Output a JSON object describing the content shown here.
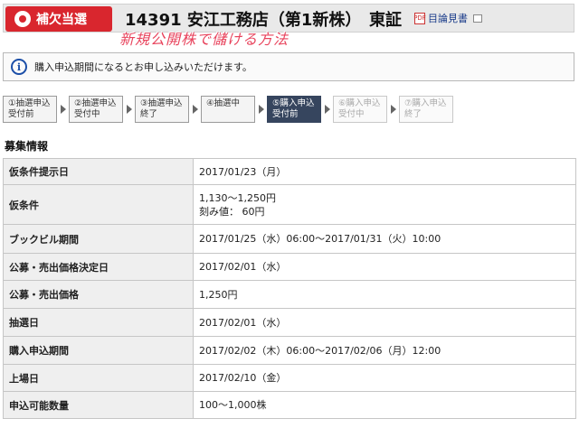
{
  "header": {
    "badge": "補欠当選",
    "title": "14391 安江工務店（第1新株）",
    "market": "東証",
    "prospectus_link": "目論見書",
    "overlay_text": "新規公開株で儲ける方法",
    "icons": [
      "pin-icon",
      "pdf-icon",
      "external-window-icon"
    ]
  },
  "notice": {
    "icon": "info-icon",
    "text": "購入申込期間になるとお申し込みいただけます。"
  },
  "steps": [
    {
      "label": "①抽選申込\n受付前",
      "state": "done"
    },
    {
      "label": "②抽選申込\n受付中",
      "state": "done"
    },
    {
      "label": "③抽選申込\n終了",
      "state": "done"
    },
    {
      "label": "④抽選中",
      "state": "done"
    },
    {
      "label": "⑤購入申込\n受付前",
      "state": "active"
    },
    {
      "label": "⑥購入申込\n受付中",
      "state": "future"
    },
    {
      "label": "⑦購入申込\n終了",
      "state": "future"
    }
  ],
  "section": {
    "title": "募集情報"
  },
  "rows": [
    {
      "key": "仮条件提示日",
      "value": [
        "2017/01/23（月）"
      ]
    },
    {
      "key": "仮条件",
      "value": [
        "1,130～1,250円",
        "刻み値： 60円"
      ]
    },
    {
      "key": "ブックビル期間",
      "value": [
        "2017/01/25（水）06:00～2017/01/31（火）10:00"
      ]
    },
    {
      "key": "公募・売出価格決定日",
      "value": [
        "2017/02/01（水）"
      ]
    },
    {
      "key": "公募・売出価格",
      "value": [
        "1,250円"
      ]
    },
    {
      "key": "抽選日",
      "value": [
        "2017/02/01（水）"
      ]
    },
    {
      "key": "購入申込期間",
      "value": [
        "2017/02/02（木）06:00～2017/02/06（月）12:00"
      ]
    },
    {
      "key": "上場日",
      "value": [
        "2017/02/10（金）"
      ]
    },
    {
      "key": "申込可能数量",
      "value": [
        "100～1,000株"
      ]
    }
  ],
  "colors": {
    "badge": "#d9262e",
    "active_step": "#36455e",
    "link": "#1a3c8a",
    "overlay": "#e8435c"
  }
}
